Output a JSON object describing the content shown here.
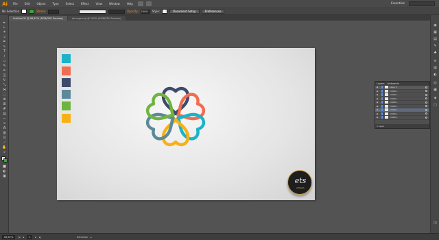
{
  "app": {
    "logo_text": "Ai",
    "workspace": "Essentials"
  },
  "menu": [
    "File",
    "Edit",
    "Object",
    "Type",
    "Select",
    "Effect",
    "View",
    "Window",
    "Help"
  ],
  "control_bar": {
    "selection_label": "No Selection",
    "stroke_label": "Stroke:",
    "opacity_label": "Opacity:",
    "opacity_value": "100%",
    "style_label": "Style:",
    "document_setup": "Document Setup",
    "preferences": "Preferences"
  },
  "tabs": [
    {
      "label": "Untitled-2* @ 66,67% (RGB/GPU Preview)",
      "active": true
    },
    {
      "label": "ets-logo.svg @ 100% (RGB/GPU Preview)",
      "active": false
    }
  ],
  "color_swatches": [
    "#1bb3c8",
    "#f26d50",
    "#3e4a6b",
    "#5a8a99",
    "#6fb43f",
    "#f7b116"
  ],
  "logo": {
    "text": "ets",
    "sub": "DESIGNS"
  },
  "layers_panel": {
    "tabs": [
      "Layers",
      "Artboards"
    ],
    "rows": [
      {
        "name": "Layer 1",
        "color": "#5c8ee0"
      },
      {
        "name": "<Path>",
        "color": "#5c8ee0"
      },
      {
        "name": "<Path>",
        "color": "#5c8ee0"
      },
      {
        "name": "<Path>",
        "color": "#5c8ee0"
      },
      {
        "name": "<Path>",
        "color": "#5c8ee0"
      },
      {
        "name": "<Path>",
        "color": "#5c8ee0"
      },
      {
        "name": "<Path>",
        "color": "#5c8ee0"
      },
      {
        "name": "<Path>",
        "color": "#5c8ee0"
      },
      {
        "name": "<Path>",
        "color": "#5c8ee0"
      }
    ],
    "footer": "1 Layer"
  },
  "status_bar": {
    "zoom": "66,67%",
    "page": "1",
    "tool": "Selection"
  },
  "clover_colors": [
    "#3e4a6b",
    "#f26d50",
    "#1bb3c8",
    "#f7b116",
    "#5a8a99",
    "#6fb43f"
  ]
}
